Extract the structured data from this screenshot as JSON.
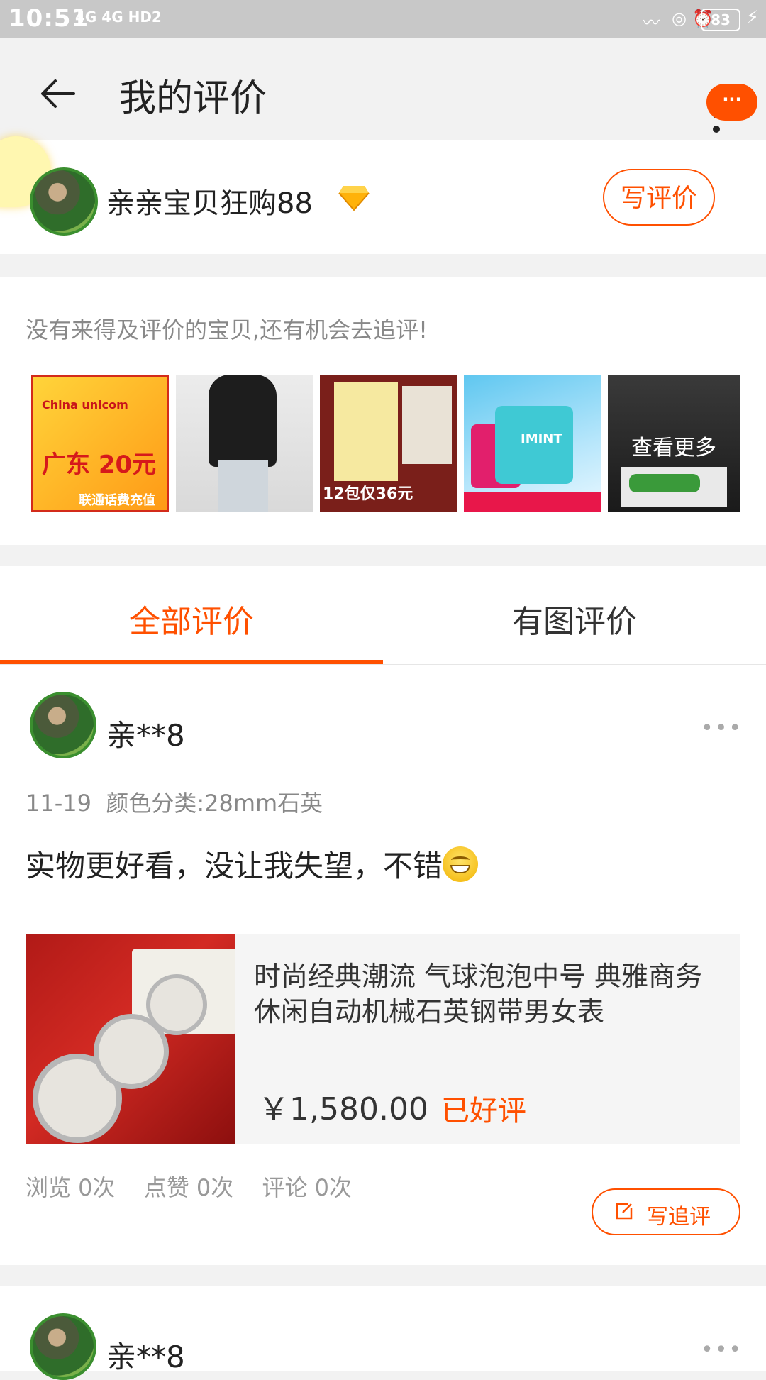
{
  "status_bar": {
    "time": "10:51",
    "network": "4G 4G HD2",
    "battery": "83"
  },
  "header": {
    "title": "我的评价",
    "badge": "···"
  },
  "profile": {
    "username": "亲亲宝贝狂购88",
    "write_review_label": "写评价"
  },
  "pending": {
    "hint": "没有来得及评价的宝贝,还有机会去追评!",
    "thumbnails": [
      {
        "caption": "联通话费充值",
        "headline": "广东 20元"
      },
      {
        "caption": ""
      },
      {
        "caption": "12包仅36元"
      },
      {
        "caption": "IMINT"
      },
      {
        "caption": ""
      }
    ],
    "see_more": "查看更多"
  },
  "tabs": [
    {
      "label": "全部评价",
      "active": true
    },
    {
      "label": "有图评价",
      "active": false
    }
  ],
  "reviews": [
    {
      "user": "亲**8",
      "date": "11-19",
      "variant": "颜色分类:28mm石英",
      "text": "实物更好看，没让我失望，不错",
      "product": {
        "title": "时尚经典潮流 气球泡泡中号 典雅商务休闲自动机械石英钢带男女表",
        "price": "￥1,580.00",
        "status": "已好评"
      },
      "stats": {
        "views": "浏览 0次",
        "likes": "点赞 0次",
        "comments": "评论 0次"
      },
      "followup_label": "写追评"
    },
    {
      "user": "亲**8"
    }
  ],
  "colors": {
    "accent": "#ff5000",
    "background": "#f2f2f2"
  }
}
